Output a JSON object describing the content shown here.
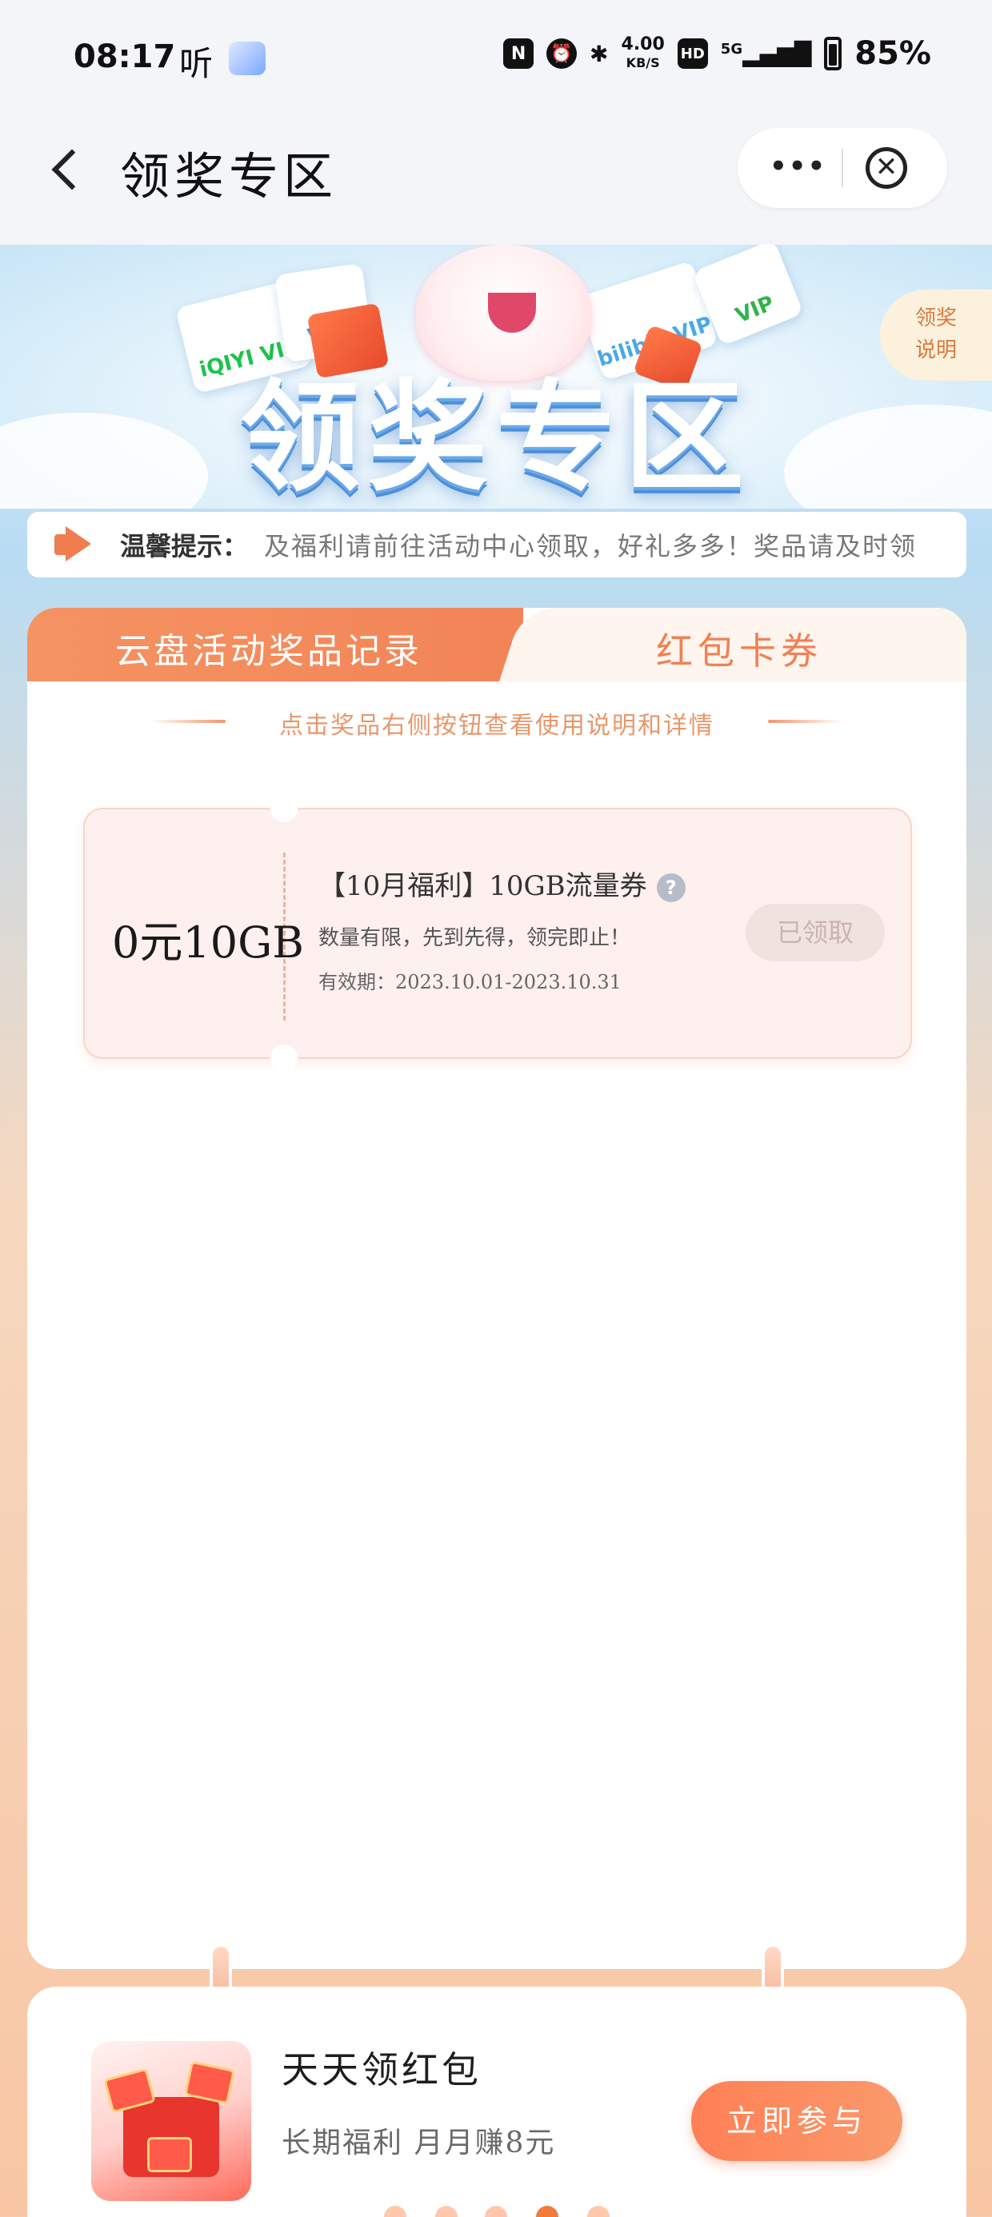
{
  "status_bar": {
    "time": "08:17",
    "listen_label": "听",
    "nfc_icon": "N",
    "speed_value": "4.00",
    "speed_unit": "KB/S",
    "hd_label": "HD",
    "network": "5G",
    "battery": "85%",
    "icons": [
      "nfc-icon",
      "alarm-icon",
      "bluetooth-icon",
      "hd-icon",
      "signal-icon",
      "battery-icon"
    ]
  },
  "nav": {
    "title": "领奖专区",
    "more_label": "•••",
    "close_label": "✕"
  },
  "hero": {
    "title": "领奖专区",
    "vip_cards": [
      "iQIYI VIP",
      "VIP",
      "bilibili VIP",
      "VIP"
    ],
    "rules_line1": "领奖",
    "rules_line2": "说明"
  },
  "notice": {
    "label": "温馨提示：",
    "text": "及福利请前往活动中心领取，好礼多多！奖品请及时领"
  },
  "tabs": [
    {
      "label": "云盘活动奖品记录",
      "active": false
    },
    {
      "label": "红包卡券",
      "active": true
    }
  ],
  "hint": "点击奖品右侧按钮查看使用说明和详情",
  "coupons": [
    {
      "value": "0元10GB",
      "title": "【10月福利】10GB流量券",
      "help_icon": "?",
      "desc": "数量有限，先到先得，领完即止！",
      "validity": "有效期：2023.10.01-2023.10.31",
      "button_label": "已领取",
      "claimed": true
    }
  ],
  "promo": {
    "title": "天天领红包",
    "subtitle": "长期福利 月月赚8元",
    "button_label": "立即参与"
  },
  "pager": {
    "count": 5,
    "active_index": 3
  },
  "colors": {
    "accent": "#f28457",
    "tab_inactive_bg": "#fff5ef",
    "coupon_bg": "#fdf0ee",
    "claimed_btn_bg": "#f0e2df"
  }
}
